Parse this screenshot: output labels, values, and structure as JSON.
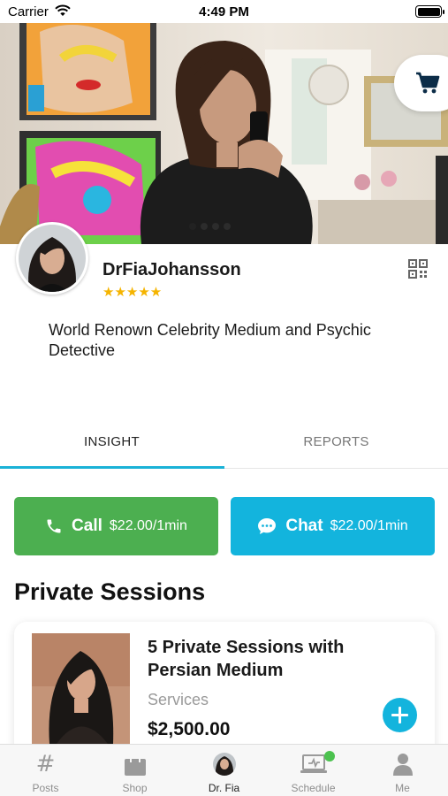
{
  "status_bar": {
    "carrier": "Carrier",
    "time": "4:49 PM"
  },
  "profile": {
    "name": "DrFiaJohansson",
    "rating_stars": "★★★★★",
    "rating_value": 5,
    "bio": "World Renown Celebrity Medium and Psychic Detective"
  },
  "carousel": {
    "total": 4,
    "active_index": 0
  },
  "tabs": [
    {
      "label": "INSIGHT",
      "active": true
    },
    {
      "label": "REPORTS",
      "active": false
    }
  ],
  "actions": {
    "call": {
      "label": "Call",
      "price": "$22.00/1min"
    },
    "chat": {
      "label": "Chat",
      "price": "$22.00/1min"
    }
  },
  "section_title": "Private Sessions",
  "session": {
    "title": "5 Private Sessions with Persian Medium",
    "category": "Services",
    "price": "$2,500.00"
  },
  "bottom_nav": [
    {
      "label": "Posts",
      "icon": "hashtag-icon",
      "active": false
    },
    {
      "label": "Shop",
      "icon": "shopping-bag-icon",
      "active": false
    },
    {
      "label": "Dr. Fia",
      "icon": "profile-avatar-icon",
      "active": true
    },
    {
      "label": "Schedule",
      "icon": "calendar-laptop-icon",
      "active": false,
      "badge": true
    },
    {
      "label": "Me",
      "icon": "person-icon",
      "active": false
    }
  ],
  "colors": {
    "accent": "#13b4dd",
    "call_green": "#4caf50",
    "tab_indicator": "#1ab2d7",
    "star": "#f5b400",
    "badge_green": "#4cc24f"
  }
}
